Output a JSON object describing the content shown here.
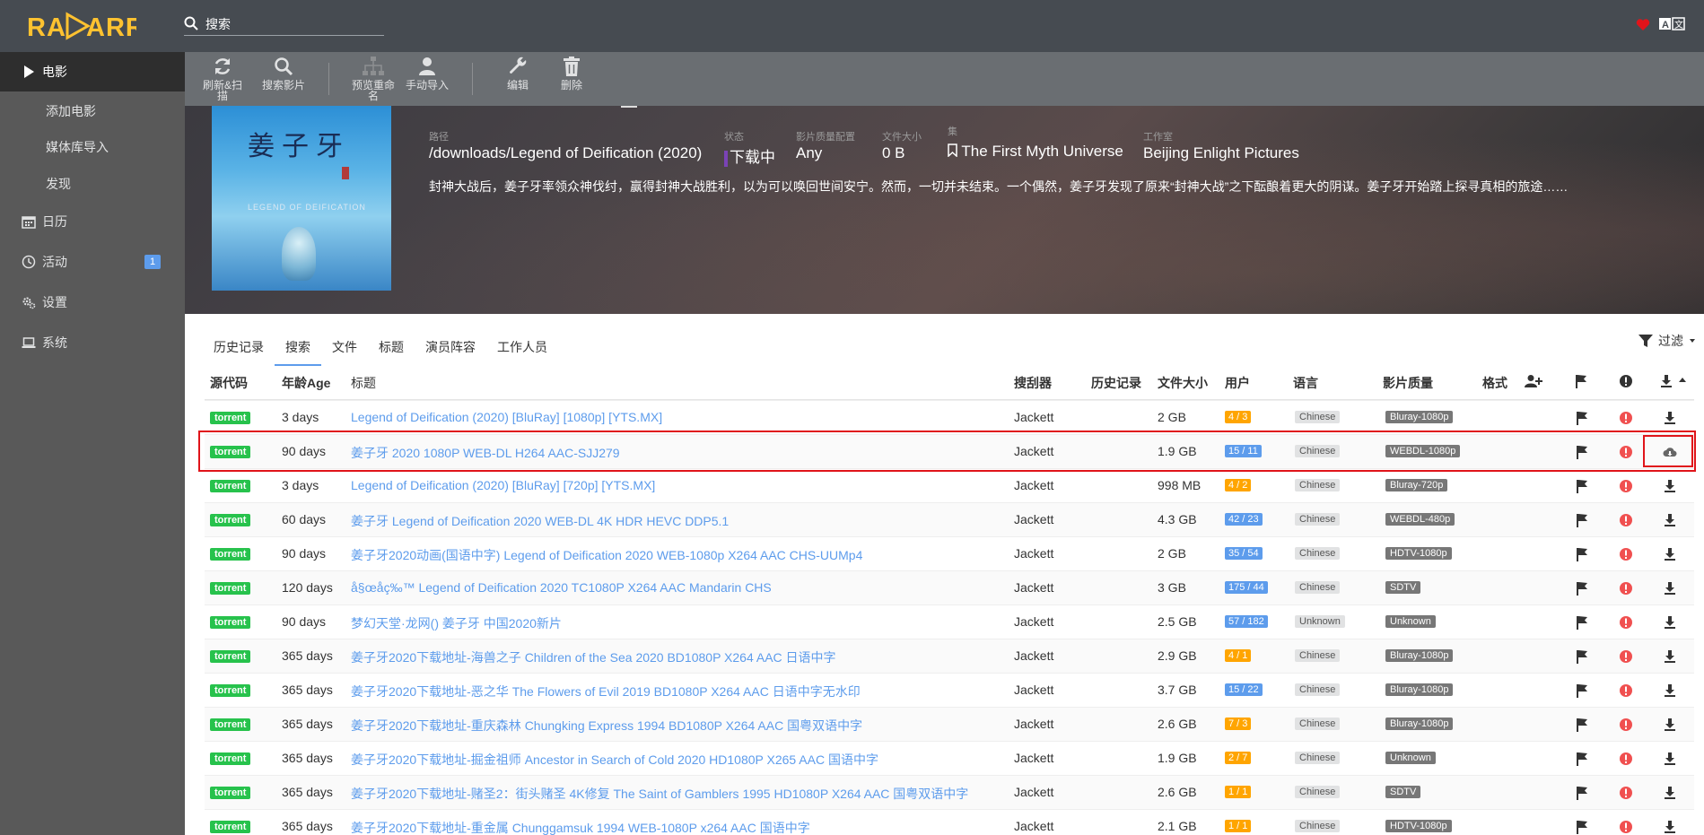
{
  "app": {
    "logo_text": "RADARR"
  },
  "search": {
    "placeholder": "搜索"
  },
  "sidebar": {
    "items": [
      {
        "label": "电影",
        "icon": "play-icon",
        "active": true
      },
      {
        "label": "添加电影",
        "sub": true
      },
      {
        "label": "媒体库导入",
        "sub": true
      },
      {
        "label": "发现",
        "sub": true
      },
      {
        "label": "日历",
        "icon": "calendar-icon"
      },
      {
        "label": "活动",
        "icon": "clock-icon",
        "badge": "1"
      },
      {
        "label": "设置",
        "icon": "gears-icon"
      },
      {
        "label": "系统",
        "icon": "laptop-icon"
      }
    ]
  },
  "toolbar": {
    "refresh_label": "刷新&扫描",
    "search_label": "搜索影片",
    "preview_rename_label": "预览重命名",
    "manual_import_label": "手动导入",
    "edit_label": "编辑",
    "delete_label": "删除"
  },
  "movie": {
    "path_label": "路径",
    "path": "/downloads/Legend of Deification (2020)",
    "status_label": "状态",
    "status": "下载中",
    "quality_profile_label": "影片质量配置",
    "quality_profile": "Any",
    "size_label": "文件大小",
    "size": "0 B",
    "collection_label": "集",
    "collection": "The First Myth Universe",
    "studio_label": "工作室",
    "studio": "Beijing Enlight Pictures",
    "overview": "封神大战后，姜子牙率领众神伐纣，赢得封神大战胜利，以为可以唤回世间安宁。然而，一切并未结束。一个偶然，姜子牙发现了原来“封神大战”之下酝酿着更大的阴谋。姜子牙开始踏上探寻真相的旅途……",
    "poster_title": "姜子牙",
    "poster_subtitle": "LEGEND OF DEIFICATION"
  },
  "tabs": [
    "历史记录",
    "搜索",
    "文件",
    "标题",
    "演员阵容",
    "工作人员"
  ],
  "active_tab": "搜索",
  "filter_label": "过滤",
  "table": {
    "headers": {
      "protocol": "源代码",
      "age": "年龄Age",
      "title": "标题",
      "indexer": "搜刮器",
      "history": "历史记录",
      "size": "文件大小",
      "peers": "用户",
      "language": "语言",
      "quality": "影片质量",
      "format": "格式"
    },
    "rows": [
      {
        "protocol": "torrent",
        "age": "3 days",
        "title": "Legend of Deification (2020) [BluRay] [1080p] [YTS.MX]",
        "indexer": "Jackett",
        "size": "2 GB",
        "peers": "4 / 3",
        "peers_style": "warn",
        "language": "Chinese",
        "quality": "Bluray-1080p"
      },
      {
        "protocol": "torrent",
        "age": "90 days",
        "title": "姜子牙 2020 1080P WEB-DL H264 AAC-SJJ279",
        "indexer": "Jackett",
        "size": "1.9 GB",
        "peers": "15 / 11",
        "peers_style": "ok",
        "language": "Chinese",
        "quality": "WEBDL-1080p",
        "highlighted": true
      },
      {
        "protocol": "torrent",
        "age": "3 days",
        "title": "Legend of Deification (2020) [BluRay] [720p] [YTS.MX]",
        "indexer": "Jackett",
        "size": "998 MB",
        "peers": "4 / 2",
        "peers_style": "warn",
        "language": "Chinese",
        "quality": "Bluray-720p"
      },
      {
        "protocol": "torrent",
        "age": "60 days",
        "title": "姜子牙 Legend of Deification 2020 WEB-DL 4K HDR HEVC DDP5.1",
        "indexer": "Jackett",
        "size": "4.3 GB",
        "peers": "42 / 23",
        "peers_style": "ok",
        "language": "Chinese",
        "quality": "WEBDL-480p"
      },
      {
        "protocol": "torrent",
        "age": "90 days",
        "title": "姜子牙2020动画(国语中字) Legend of Deification 2020 WEB-1080p X264 AAC CHS-UUMp4",
        "indexer": "Jackett",
        "size": "2 GB",
        "peers": "35 / 54",
        "peers_style": "ok",
        "language": "Chinese",
        "quality": "HDTV-1080p"
      },
      {
        "protocol": "torrent",
        "age": "120 days",
        "title": "å§œå­ç‰™ Legend of Deification 2020 TC1080P X264 AAC Mandarin CHS",
        "indexer": "Jackett",
        "size": "3 GB",
        "peers": "175 / 44",
        "peers_style": "ok",
        "language": "Chinese",
        "quality": "SDTV"
      },
      {
        "protocol": "torrent",
        "age": "90 days",
        "title": "梦幻天堂·龙网() 姜子牙 中国2020新片",
        "indexer": "Jackett",
        "size": "2.5 GB",
        "peers": "57 / 182",
        "peers_style": "ok",
        "language": "Unknown",
        "quality": "Unknown"
      },
      {
        "protocol": "torrent",
        "age": "365 days",
        "title": "姜子牙2020下载地址-海兽之子 Children of the Sea 2020 BD1080P X264 AAC 日语中字",
        "indexer": "Jackett",
        "size": "2.9 GB",
        "peers": "4 / 1",
        "peers_style": "warn",
        "language": "Chinese",
        "quality": "Bluray-1080p"
      },
      {
        "protocol": "torrent",
        "age": "365 days",
        "title": "姜子牙2020下载地址-恶之华 The Flowers of Evil 2019 BD1080P X264 AAC 日语中字无水印",
        "indexer": "Jackett",
        "size": "3.7 GB",
        "peers": "15 / 22",
        "peers_style": "ok",
        "language": "Chinese",
        "quality": "Bluray-1080p"
      },
      {
        "protocol": "torrent",
        "age": "365 days",
        "title": "姜子牙2020下载地址-重庆森林 Chungking Express 1994 BD1080P X264 AAC 国粤双语中字",
        "indexer": "Jackett",
        "size": "2.6 GB",
        "peers": "7 / 3",
        "peers_style": "warn",
        "language": "Chinese",
        "quality": "Bluray-1080p"
      },
      {
        "protocol": "torrent",
        "age": "365 days",
        "title": "姜子牙2020下载地址-掘金祖师 Ancestor in Search of Cold 2020 HD1080P X265 AAC 国语中字",
        "indexer": "Jackett",
        "size": "1.9 GB",
        "peers": "2 / 7",
        "peers_style": "warn",
        "language": "Chinese",
        "quality": "Unknown"
      },
      {
        "protocol": "torrent",
        "age": "365 days",
        "title": "姜子牙2020下载地址-赌圣2：街头赌圣 4K修复 The Saint of Gamblers 1995 HD1080P X264 AAC 国粤双语中字",
        "indexer": "Jackett",
        "size": "2.6 GB",
        "peers": "1 / 1",
        "peers_style": "warn",
        "language": "Chinese",
        "quality": "SDTV"
      },
      {
        "protocol": "torrent",
        "age": "365 days",
        "title": "姜子牙2020下载地址-重金属 Chunggamsuk 1994 WEB-1080P x264 AAC 国语中字",
        "indexer": "Jackett",
        "size": "2.1 GB",
        "peers": "1 / 1",
        "peers_style": "warn",
        "language": "Chinese",
        "quality": "HDTV-1080p"
      }
    ]
  },
  "colors": {
    "topbar": "#464b51",
    "sidebar": "#595959",
    "toolbar": "#6a6e72",
    "accent": "#5d9cec",
    "torrent": "#27c24c",
    "warning": "#ffa500",
    "danger": "#f05050",
    "highlight_box": "#e0141a"
  }
}
